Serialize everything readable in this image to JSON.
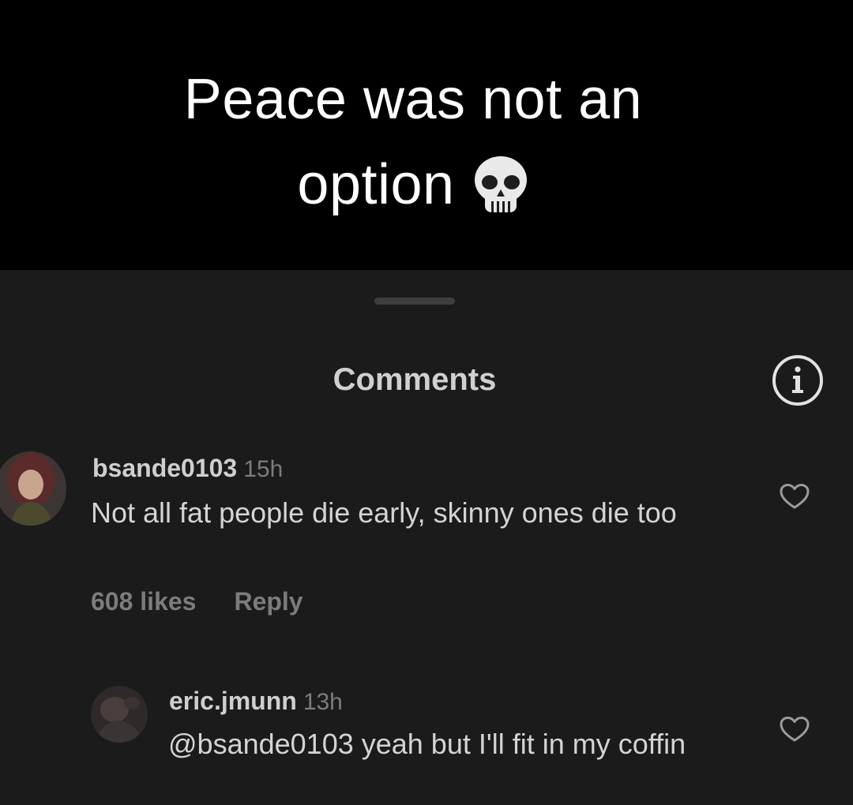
{
  "caption": {
    "line1": "Peace was not an",
    "line2": "option",
    "emoji_icon": "skull-icon"
  },
  "sheet": {
    "title": "Comments",
    "info_icon": "info-icon",
    "background": "#1b1b1b"
  },
  "comments": [
    {
      "username": "bsande0103",
      "time": "15h",
      "text": "Not all fat people die early, skinny ones die too",
      "likes": "608 likes",
      "reply_label": "Reply",
      "like_icon": "heart-outline-icon"
    },
    {
      "username": "eric.jmunn",
      "time": "13h",
      "text": "@bsande0103 yeah but I'll fit in my coffin",
      "like_icon": "heart-outline-icon"
    }
  ]
}
